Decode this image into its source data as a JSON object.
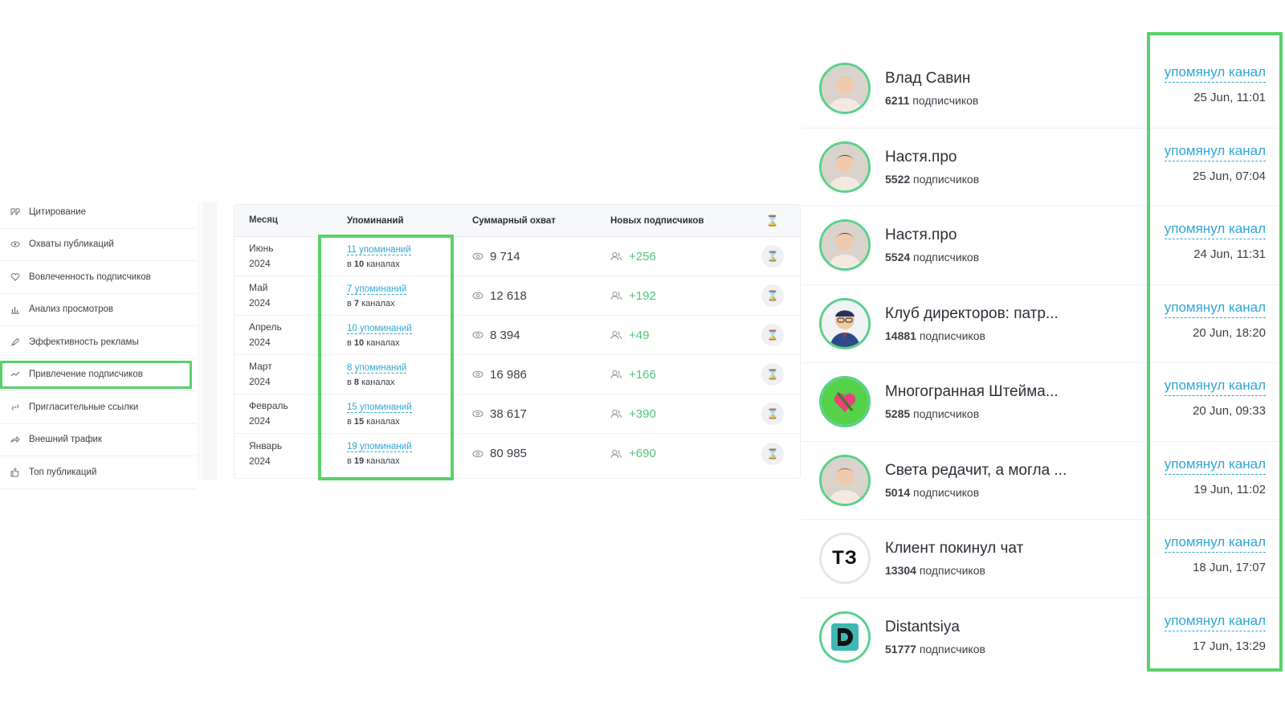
{
  "sidebar": {
    "items": [
      {
        "label": "Цитирование",
        "icon": "quote-icon"
      },
      {
        "label": "Охваты публикаций",
        "icon": "eye-icon"
      },
      {
        "label": "Вовлеченность подписчиков",
        "icon": "heart-icon"
      },
      {
        "label": "Анализ просмотров",
        "icon": "bar-chart-icon"
      },
      {
        "label": "Эффективность рекламы",
        "icon": "rocket-icon"
      },
      {
        "label": "Привлечение подписчиков",
        "icon": "trend-icon",
        "active": true
      },
      {
        "label": "Пригласительные ссылки",
        "icon": "link-icon"
      },
      {
        "label": "Внешний трафик",
        "icon": "share-arrow-icon"
      },
      {
        "label": "Топ публикаций",
        "icon": "thumbs-up-icon"
      }
    ]
  },
  "table": {
    "headers": {
      "month": "Месяц",
      "mentions": "Упоминаний",
      "reach": "Суммарный охват",
      "new_subs": "Новых подписчиков",
      "action": "⌛"
    },
    "rows": [
      {
        "month": "Июнь",
        "year": "2024",
        "mentions": "11 упоминаний",
        "in": "в",
        "channels_count": "10",
        "channels_word": "каналах",
        "reach": "9 714",
        "subs": "+256"
      },
      {
        "month": "Май",
        "year": "2024",
        "mentions": "7 упоминаний",
        "in": "в",
        "channels_count": "7",
        "channels_word": "каналах",
        "reach": "12 618",
        "subs": "+192"
      },
      {
        "month": "Апрель",
        "year": "2024",
        "mentions": "10 упоминаний",
        "in": "в",
        "channels_count": "10",
        "channels_word": "каналах",
        "reach": "8 394",
        "subs": "+49"
      },
      {
        "month": "Март",
        "year": "2024",
        "mentions": "8 упоминаний",
        "in": "в",
        "channels_count": "8",
        "channels_word": "каналах",
        "reach": "16 986",
        "subs": "+166"
      },
      {
        "month": "Февраль",
        "year": "2024",
        "mentions": "15 упоминаний",
        "in": "в",
        "channels_count": "15",
        "channels_word": "каналах",
        "reach": "38 617",
        "subs": "+390"
      },
      {
        "month": "Январь",
        "year": "2024",
        "mentions": "19 упоминаний",
        "in": "в",
        "channels_count": "19",
        "channels_word": "каналах",
        "reach": "80 985",
        "subs": "+690"
      }
    ]
  },
  "mentions_list": {
    "items": [
      {
        "name": "Влад Савин",
        "subs_count": "6211",
        "subs_word": "подписчиков",
        "action": "упомянул канал",
        "date": "25 Jun, 11:01",
        "avatar": "photo"
      },
      {
        "name": "Настя.про",
        "subs_count": "5522",
        "subs_word": "подписчиков",
        "action": "упомянул канал",
        "date": "25 Jun, 07:04",
        "avatar": "photo"
      },
      {
        "name": "Настя.про",
        "subs_count": "5524",
        "subs_word": "подписчиков",
        "action": "упомянул канал",
        "date": "24 Jun, 11:31",
        "avatar": "photo"
      },
      {
        "name": "Клуб директоров: патр...",
        "subs_count": "14881",
        "subs_word": "подписчиков",
        "action": "упомянул канал",
        "date": "20 Jun, 18:20",
        "avatar": "cartoon"
      },
      {
        "name": "Многогранная Штейма...",
        "subs_count": "5285",
        "subs_word": "подписчиков",
        "action": "упомянул канал",
        "date": "20 Jun, 09:33",
        "avatar": "heart"
      },
      {
        "name": "Света редачит, а могла ...",
        "subs_count": "5014",
        "subs_word": "подписчиков",
        "action": "упомянул канал",
        "date": "19 Jun, 11:02",
        "avatar": "photo"
      },
      {
        "name": "Клиент покинул чат",
        "subs_count": "13304",
        "subs_word": "подписчиков",
        "action": "упомянул канал",
        "date": "18 Jun, 17:07",
        "avatar": "text",
        "avatar_text": "ТЗ"
      },
      {
        "name": "Distantsiya",
        "subs_count": "51777",
        "subs_word": "подписчиков",
        "action": "упомянул канал",
        "date": "17 Jun, 13:29",
        "avatar": "logo",
        "avatar_text": "D"
      }
    ]
  },
  "colors": {
    "highlight": "#5ad16a",
    "link": "#2fa7d6",
    "positive": "#4fc47a",
    "avatar_ring": "#5ad18a"
  }
}
